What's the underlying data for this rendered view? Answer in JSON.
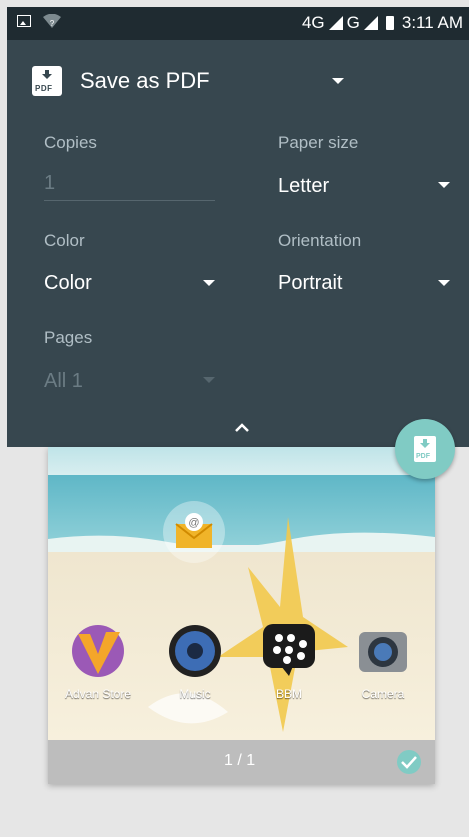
{
  "status_bar": {
    "network_1": "4G",
    "network_2": "G",
    "time": "3:11 AM"
  },
  "destination": {
    "label": "Save as PDF",
    "icon_text": "PDF"
  },
  "options": {
    "copies": {
      "label": "Copies",
      "value": "1"
    },
    "paper_size": {
      "label": "Paper size",
      "value": "Letter"
    },
    "color": {
      "label": "Color",
      "value": "Color"
    },
    "orientation": {
      "label": "Orientation",
      "value": "Portrait"
    },
    "pages": {
      "label": "Pages",
      "value": "All 1"
    }
  },
  "fab": {
    "icon_text": "PDF"
  },
  "preview": {
    "apps": [
      {
        "label": "Advan Store"
      },
      {
        "label": "Music"
      },
      {
        "label": "BBM"
      },
      {
        "label": "Camera"
      }
    ],
    "page_indicator": "1 / 1"
  },
  "colors": {
    "panel": "#37474f",
    "accent": "#80cbc4",
    "status_bar": "#1f2b31"
  }
}
